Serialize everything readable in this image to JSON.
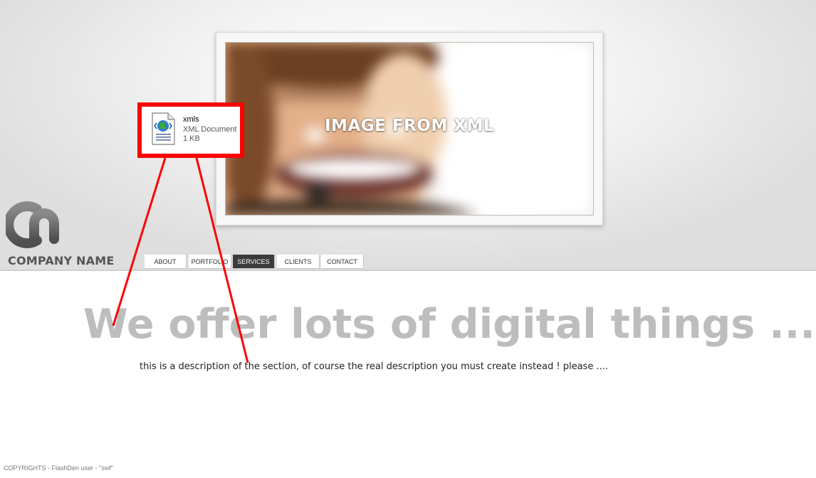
{
  "brand": {
    "company_name": "COMPANY NAME"
  },
  "hero": {
    "caption": "IMAGE FROM XML"
  },
  "file_callout": {
    "name": "xmls",
    "type": "XML Document",
    "size": "1 KB",
    "icon": "xml-document-icon",
    "highlight_color": "#ff0000"
  },
  "nav": {
    "items": [
      {
        "label": "ABOUT",
        "active": false
      },
      {
        "label": "PORTFOLIO",
        "active": false
      },
      {
        "label": "SERVICES",
        "active": true
      },
      {
        "label": "CLIENTS",
        "active": false
      },
      {
        "label": "CONTACT",
        "active": false
      }
    ]
  },
  "content": {
    "headline": "We offer lots of digital things ...",
    "description": "this is a description of the section, of course the real description you must create instead ! please ...."
  },
  "footer": {
    "copyright": "COPYRIGHTS - FlashDen user - \"swf\""
  },
  "colors": {
    "annotation": "#ff0000",
    "nav_active_bg": "#3b3b3b",
    "headline": "#bdbdbd"
  }
}
